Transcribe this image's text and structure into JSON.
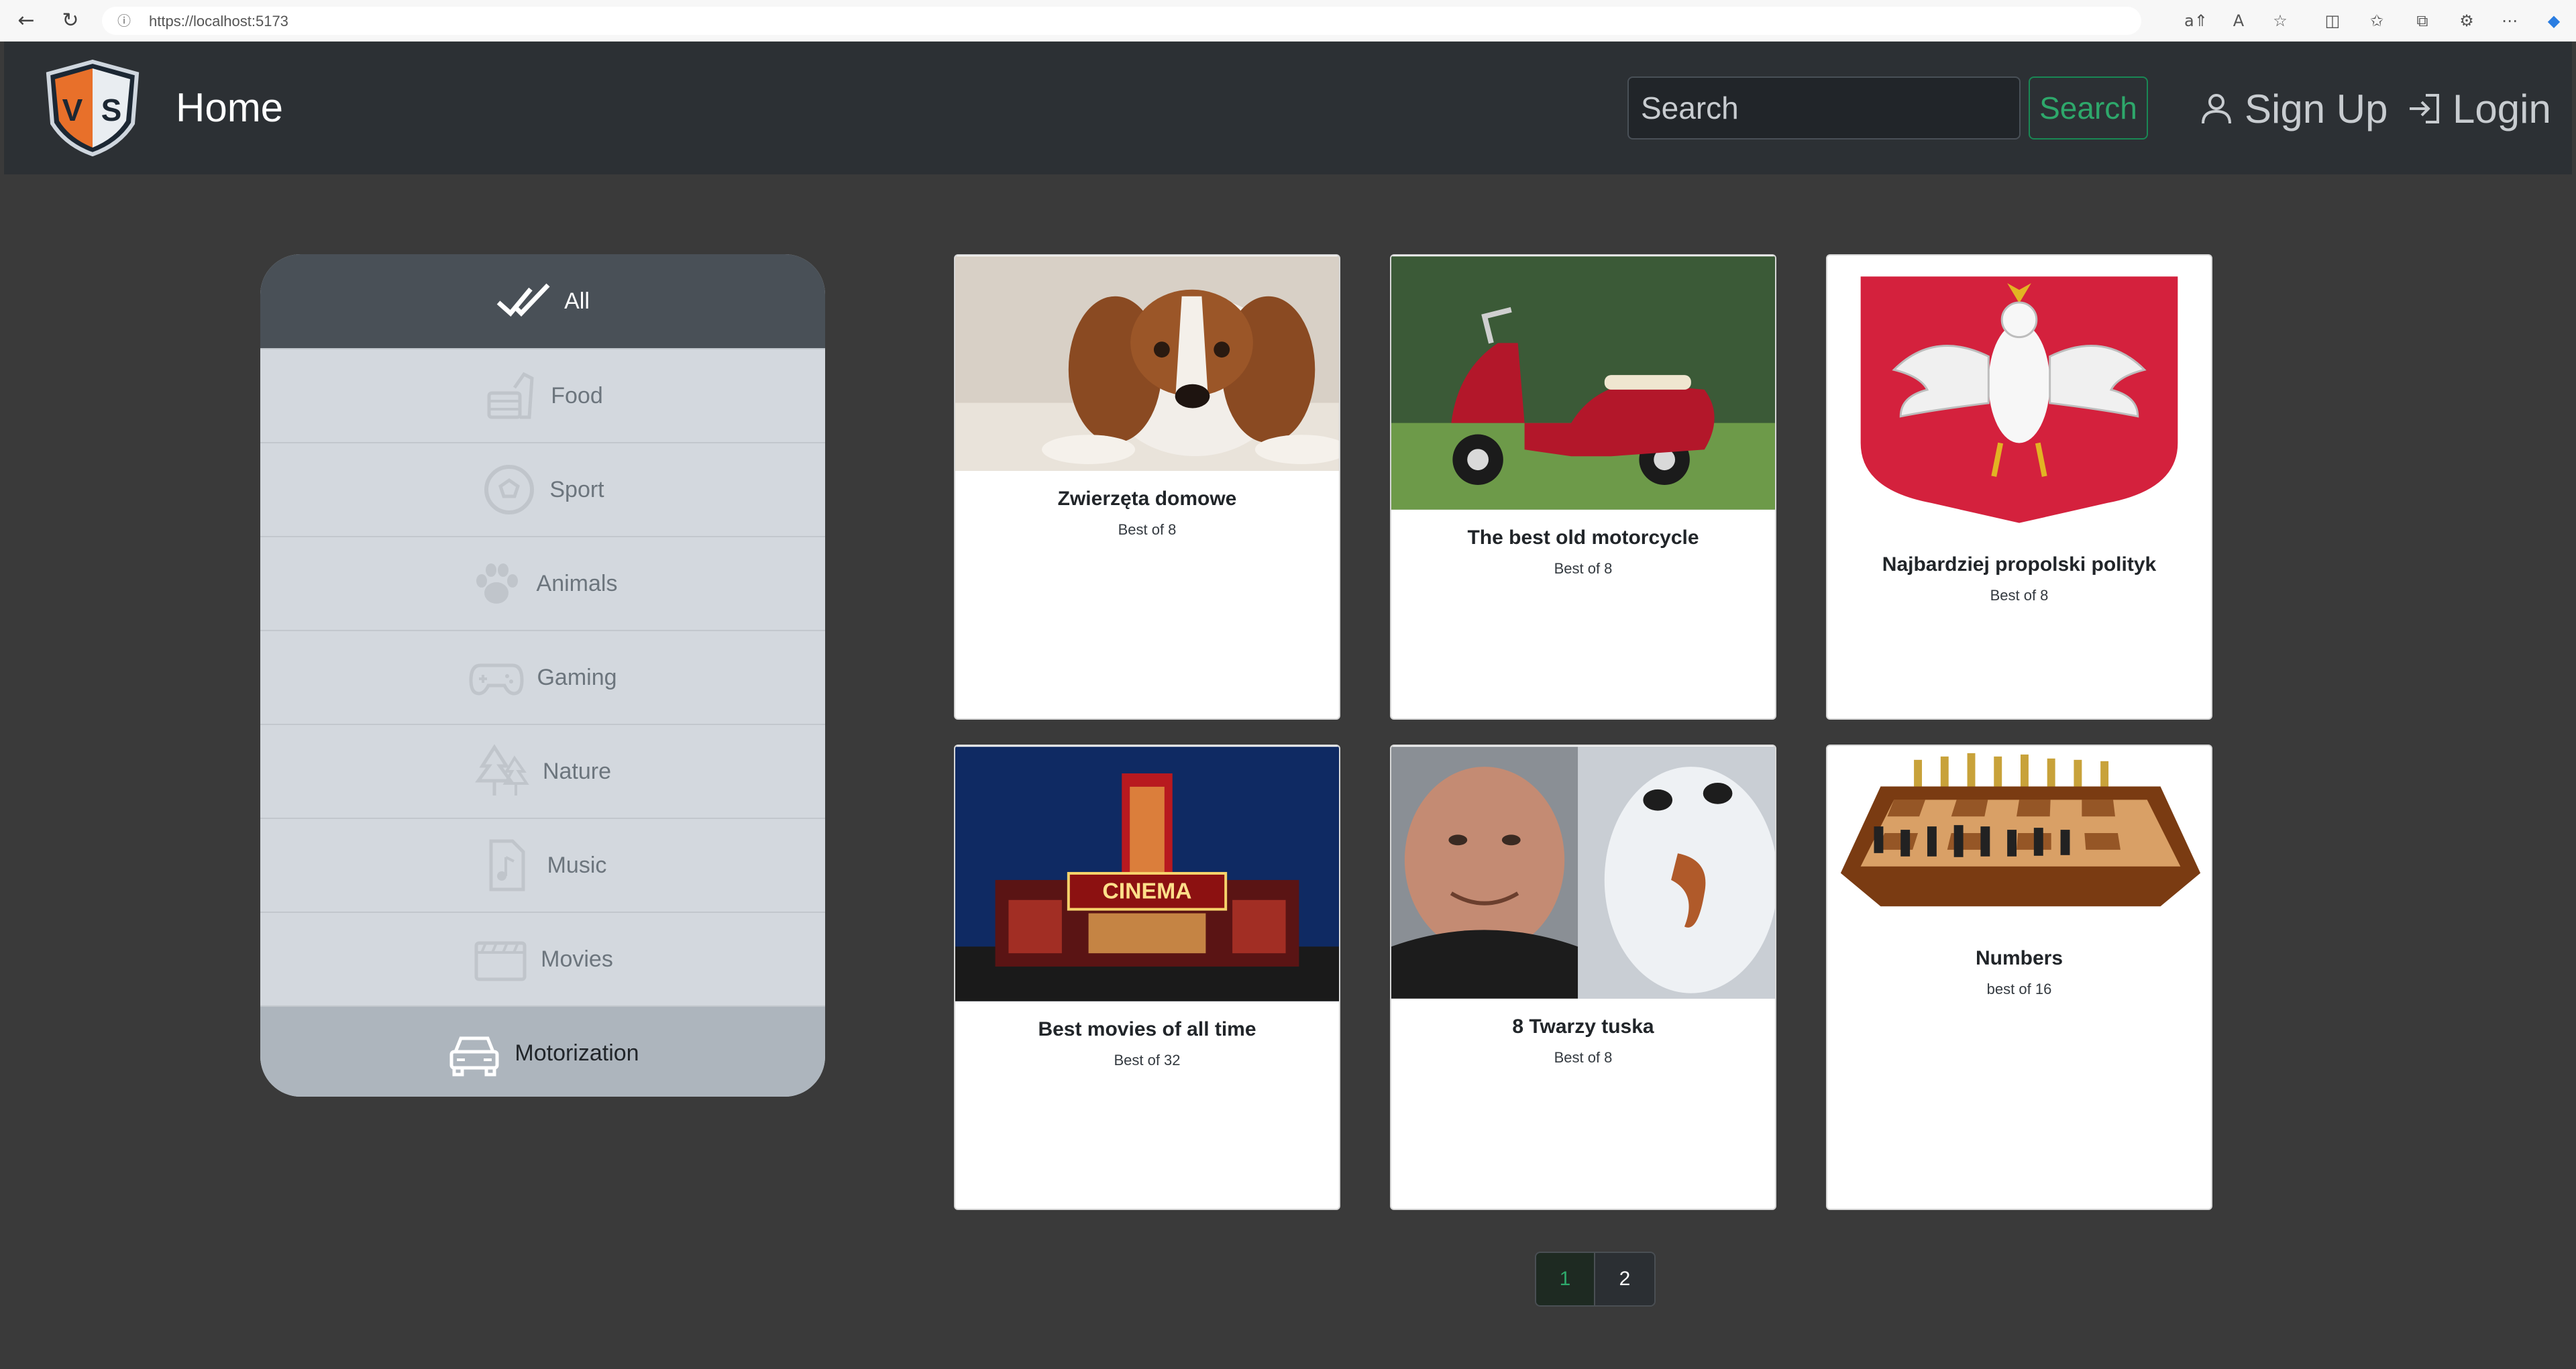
{
  "browser": {
    "url": "https://localhost:5173"
  },
  "navbar": {
    "title": "Home",
    "search_placeholder": "Search",
    "search_button": "Search",
    "signup_label": "Sign Up",
    "login_label": "Login",
    "logo_letters": [
      "V",
      "S"
    ]
  },
  "sidebar": {
    "items": [
      {
        "label": "All",
        "icon": "double-check-icon",
        "state": "active"
      },
      {
        "label": "Food",
        "icon": "fast-food-icon"
      },
      {
        "label": "Sport",
        "icon": "soccer-ball-icon"
      },
      {
        "label": "Animals",
        "icon": "paw-icon"
      },
      {
        "label": "Gaming",
        "icon": "gamepad-icon"
      },
      {
        "label": "Nature",
        "icon": "trees-icon"
      },
      {
        "label": "Music",
        "icon": "music-file-icon"
      },
      {
        "label": "Movies",
        "icon": "film-icon"
      },
      {
        "label": "Motorization",
        "icon": "car-icon",
        "state": "selected"
      }
    ]
  },
  "cards": [
    {
      "title": "Zwierzęta domowe",
      "subtitle": "Best of 8",
      "image": "dog-photo"
    },
    {
      "title": "The best old motorcycle",
      "subtitle": "Best of 8",
      "image": "red-scooter-photo"
    },
    {
      "title": "Najbardziej propolski polityk",
      "subtitle": "Best of 8",
      "image": "polish-eagle-emblem"
    },
    {
      "title": "Best movies of all time",
      "subtitle": "Best of 32",
      "image": "cinema-photo"
    },
    {
      "title": "8 Twarzy tuska",
      "subtitle": "Best of 8",
      "image": "selfie-snowman-photo"
    },
    {
      "title": "Numbers",
      "subtitle": "best of 16",
      "image": "chess-board-photo"
    }
  ],
  "pagination": {
    "pages": [
      "1",
      "2"
    ],
    "current": "1"
  },
  "colors": {
    "navbar_bg": "#2c3034",
    "page_bg": "#3a3a3a",
    "accent_green": "#198754",
    "sidebar_bg": "#d3d8de"
  }
}
